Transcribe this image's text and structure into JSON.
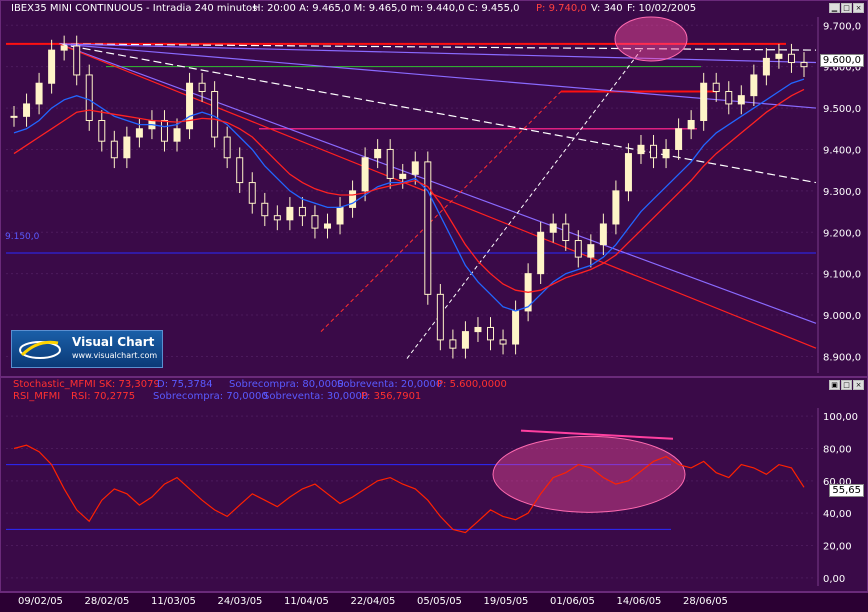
{
  "price_panel": {
    "title": "IBEX35 MINI CONTINUOUS - Intradia 240 minutos",
    "stats": "H: 20:00  A: 9.465,0  M: 9.465,0  m: 9.440,0  C: 9.455,0",
    "extra_p": "P: 9.740,0",
    "extra_v": "V: 340",
    "extra_f": "F: 10/02/2005",
    "last_value": "9.600,0",
    "left_level_label": "9.150,0",
    "logo_name": "Visual Chart",
    "logo_url": "www.visualchart.com"
  },
  "osc_panel": {
    "stoch_line": [
      "Stochastic_MFMI",
      "SK: 73,3079",
      "D: 75,3784",
      "Sobrecompra: 80,0000",
      "Sobreventa: 20,0000",
      "P: 5.600,0000"
    ],
    "rsi_line": [
      "RSI_MFMI",
      "RSI: 70,2775",
      "Sobrecompra: 70,0000",
      "Sobreventa: 30,0000",
      "P: 356,7901"
    ],
    "last_value": "55,65"
  },
  "colors": {
    "background": "#3a0a48",
    "candle": "#fff4c8",
    "ma_fast": "#2266ff",
    "ma_slow": "#ff2222",
    "rsi": "#ff2200",
    "level": "#2a2aff",
    "ellipse": "#ff5aa0"
  },
  "chart_data": [
    {
      "type": "line",
      "title": "IBEX35 MINI CONTINUOUS - Intradia 240 minutos",
      "x_tick_labels": [
        "09/02/05",
        "28/02/05",
        "11/03/05",
        "24/03/05",
        "11/04/05",
        "22/04/05",
        "05/05/05",
        "19/05/05",
        "01/06/05",
        "14/06/05",
        "28/06/05"
      ],
      "y_tick_labels": [
        "9.700,0",
        "9.600,0",
        "9.500,0",
        "9.400,0",
        "9.300,0",
        "9.200,0",
        "9.100,0",
        "9.000,0",
        "8.900,0"
      ],
      "ylim": [
        8860,
        9720
      ],
      "series": [
        {
          "name": "Close",
          "values": [
            9480,
            9510,
            9560,
            9640,
            9650,
            9580,
            9470,
            9420,
            9380,
            9430,
            9450,
            9470,
            9420,
            9450,
            9560,
            9540,
            9430,
            9380,
            9320,
            9270,
            9240,
            9230,
            9260,
            9240,
            9210,
            9220,
            9260,
            9300,
            9380,
            9400,
            9330,
            9340,
            9370,
            9050,
            8940,
            8920,
            8960,
            8970,
            8940,
            8930,
            9010,
            9100,
            9200,
            9220,
            9180,
            9140,
            9170,
            9220,
            9300,
            9390,
            9410,
            9380,
            9400,
            9450,
            9470,
            9560,
            9540,
            9510,
            9530,
            9580,
            9620,
            9630,
            9610,
            9600
          ]
        },
        {
          "values": [
            9440,
            9450,
            9470,
            9500,
            9520,
            9530,
            9520,
            9500,
            9480,
            9470,
            9460,
            9460,
            9455,
            9460,
            9480,
            9490,
            9480,
            9460,
            9430,
            9400,
            9360,
            9330,
            9300,
            9280,
            9270,
            9260,
            9260,
            9270,
            9290,
            9310,
            9320,
            9320,
            9330,
            9300,
            9240,
            9180,
            9120,
            9080,
            9050,
            9020,
            9010,
            9020,
            9050,
            9080,
            9100,
            9110,
            9120,
            9140,
            9170,
            9210,
            9250,
            9280,
            9310,
            9340,
            9370,
            9410,
            9440,
            9460,
            9480,
            9500,
            9520,
            9540,
            9560,
            9570
          ]
        },
        {
          "values": [
            9390,
            9410,
            9430,
            9450,
            9470,
            9490,
            9495,
            9490,
            9485,
            9480,
            9475,
            9470,
            9468,
            9466,
            9470,
            9475,
            9473,
            9465,
            9450,
            9430,
            9400,
            9370,
            9340,
            9320,
            9305,
            9295,
            9290,
            9290,
            9295,
            9305,
            9312,
            9318,
            9325,
            9310,
            9270,
            9220,
            9170,
            9130,
            9100,
            9075,
            9060,
            9055,
            9060,
            9075,
            9090,
            9100,
            9110,
            9125,
            9145,
            9175,
            9205,
            9235,
            9265,
            9295,
            9325,
            9360,
            9390,
            9415,
            9440,
            9465,
            9490,
            9510,
            9530,
            9545
          ]
        }
      ],
      "levels": [
        9655,
        9600,
        9450,
        9540,
        9150
      ]
    },
    {
      "type": "line",
      "y_tick_labels": [
        "100,00",
        "80,00",
        "60,00",
        "40,00",
        "20,00",
        "0,00"
      ],
      "ylim": [
        -5,
        105
      ],
      "levels": [
        70,
        30
      ],
      "series": [
        {
          "name": "RSI",
          "values": [
            80,
            82,
            78,
            70,
            55,
            42,
            35,
            48,
            55,
            52,
            45,
            50,
            58,
            62,
            55,
            48,
            42,
            38,
            45,
            52,
            48,
            44,
            50,
            55,
            58,
            52,
            46,
            50,
            55,
            60,
            62,
            58,
            55,
            48,
            38,
            30,
            28,
            35,
            42,
            38,
            36,
            40,
            52,
            62,
            65,
            70,
            68,
            62,
            58,
            60,
            66,
            72,
            75,
            70,
            68,
            72,
            65,
            62,
            70,
            68,
            64,
            70,
            68,
            56
          ]
        }
      ]
    }
  ]
}
